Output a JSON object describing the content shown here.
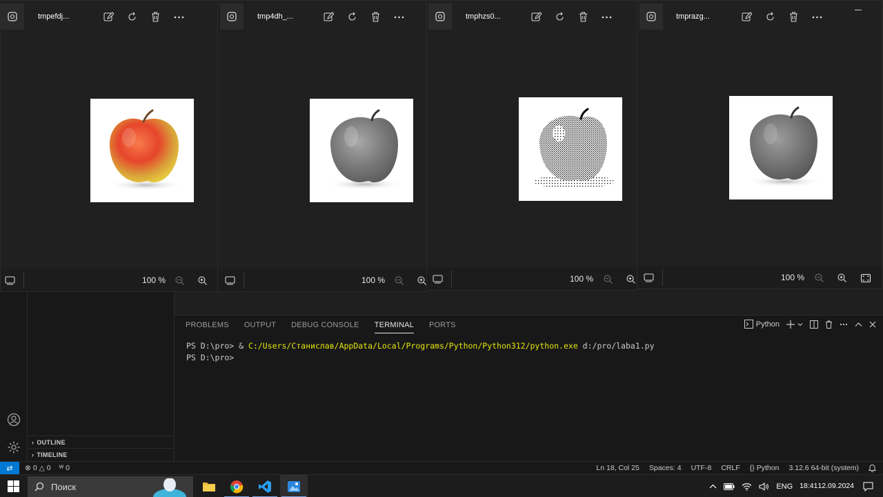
{
  "viewers": [
    {
      "title": "tmpefdj...",
      "zoom": "100 %",
      "image": "color-apple"
    },
    {
      "title": "tmp4dh_...",
      "zoom": "100 %",
      "image": "grayscale-apple"
    },
    {
      "title": "tmphzs0...",
      "zoom": "100 %",
      "image": "dithered-apple"
    },
    {
      "title": "tmprazg...",
      "zoom": "100 %",
      "image": "grayscale-apple-soft"
    }
  ],
  "vscode": {
    "panel_tabs": [
      "PROBLEMS",
      "OUTPUT",
      "DEBUG CONSOLE",
      "TERMINAL",
      "PORTS"
    ],
    "active_tab": "TERMINAL",
    "terminal_profile": "Python",
    "terminal_lines": {
      "line1_prompt": "PS D:\\pro> & ",
      "line1_path": "C:/Users/Станислав/AppData/Local/Programs/Python/Python312/python.exe",
      "line1_arg": " d:/pro/laba1.py",
      "line2_prompt": "PS D:\\pro>"
    },
    "sidebar_sections": [
      "OUTLINE",
      "TIMELINE"
    ],
    "statusbar": {
      "errors": "0",
      "warnings": "0",
      "ports": "0",
      "position": "Ln 18, Col 25",
      "spaces": "Spaces: 4",
      "encoding": "UTF-8",
      "eol": "CRLF",
      "language": "Python",
      "interpreter": "3.12.6 64-bit (system)"
    }
  },
  "taskbar": {
    "search_placeholder": "Поиск",
    "language": "ENG",
    "time": "18:41",
    "date": "12.09.2024"
  },
  "colors": {
    "accent": "#0078d4",
    "terminal_path": "#e5e510"
  }
}
